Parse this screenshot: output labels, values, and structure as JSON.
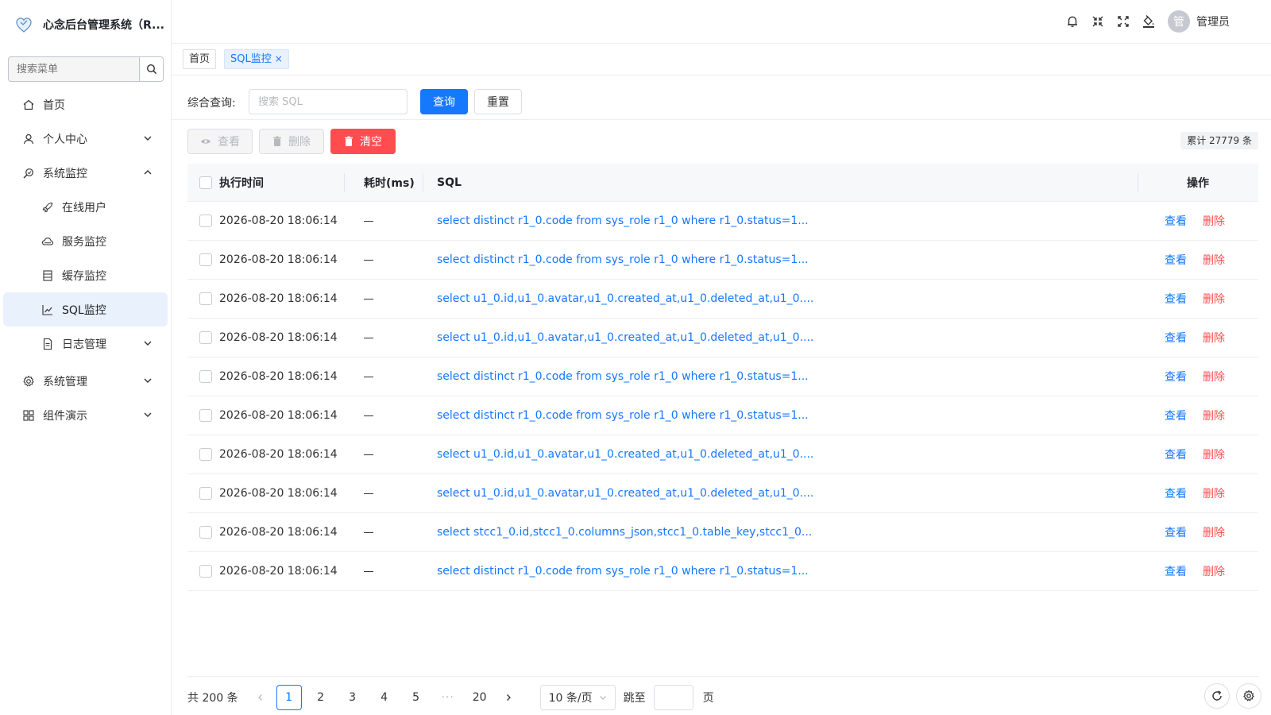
{
  "app": {
    "title": "心念后台管理系统（R...",
    "accent": "#1677ff",
    "danger": "#ff4d4f"
  },
  "sidebar": {
    "search_placeholder": "搜索菜单",
    "items": [
      {
        "label": "首页",
        "icon": "home-icon"
      },
      {
        "label": "个人中心",
        "icon": "user-icon",
        "expandable": true
      },
      {
        "label": "系统监控",
        "icon": "monitor-icon",
        "expanded": true
      },
      {
        "label": "在线用户",
        "icon": "rocket-icon"
      },
      {
        "label": "服务监控",
        "icon": "cloud-icon"
      },
      {
        "label": "缓存监控",
        "icon": "database-icon"
      },
      {
        "label": "SQL监控",
        "icon": "line-chart-icon",
        "active": true
      },
      {
        "label": "日志管理",
        "icon": "file-icon",
        "expandable": true
      },
      {
        "label": "系统管理",
        "icon": "gear-icon",
        "expandable": true
      },
      {
        "label": "组件演示",
        "icon": "grid-icon",
        "expandable": true
      }
    ]
  },
  "header": {
    "user_name": "管理员",
    "avatar_text": "管"
  },
  "tabs": [
    {
      "label": "首页"
    },
    {
      "label": "SQL监控",
      "close": "×"
    }
  ],
  "query": {
    "label": "综合查询:",
    "placeholder": "搜索 SQL",
    "search_label": "查询",
    "reset_label": "重置"
  },
  "toolbar": {
    "view_label": "查看",
    "delete_label": "删除",
    "clear_label": "清空",
    "total_text": "累计 27779 条"
  },
  "table": {
    "columns": [
      "执行时间",
      "耗时(ms)",
      "SQL",
      "操作"
    ],
    "rows": [
      {
        "time": "2026-08-20 18:06:14",
        "sql": "select distinct r1_0.code from sys_role r1_0 where r1_0.status=1..."
      },
      {
        "time": "2026-08-20 18:06:14",
        "sql": "select distinct r1_0.code from sys_role r1_0 where r1_0.status=1..."
      },
      {
        "time": "2026-08-20 18:06:14",
        "sql": "select u1_0.id,u1_0.avatar,u1_0.created_at,u1_0.deleted_at,u1_0...."
      },
      {
        "time": "2026-08-20 18:06:14",
        "sql": "select u1_0.id,u1_0.avatar,u1_0.created_at,u1_0.deleted_at,u1_0...."
      },
      {
        "time": "2026-08-20 18:06:14",
        "sql": "select distinct r1_0.code from sys_role r1_0 where r1_0.status=1..."
      },
      {
        "time": "2026-08-20 18:06:14",
        "sql": "select distinct r1_0.code from sys_role r1_0 where r1_0.status=1..."
      },
      {
        "time": "2026-08-20 18:06:14",
        "sql": "select u1_0.id,u1_0.avatar,u1_0.created_at,u1_0.deleted_at,u1_0...."
      },
      {
        "time": "2026-08-20 18:06:14",
        "sql": "select u1_0.id,u1_0.avatar,u1_0.created_at,u1_0.deleted_at,u1_0...."
      },
      {
        "time": "2026-08-20 18:06:14",
        "sql": "select stcc1_0.id,stcc1_0.columns_json,stcc1_0.table_key,stcc1_0..."
      },
      {
        "time": "2026-08-20 18:06:14",
        "sql": "select distinct r1_0.code from sys_role r1_0 where r1_0.status=1..."
      }
    ],
    "op_view": "查看",
    "op_delete": "删除"
  },
  "pagination": {
    "total_text": "共 200 条",
    "pages": [
      "1",
      "2",
      "3",
      "4",
      "5"
    ],
    "ellipsis": "···",
    "last_page": "20",
    "current": "1",
    "page_size": "10 条/页",
    "jump_label": "跳至",
    "page_label": "页"
  }
}
